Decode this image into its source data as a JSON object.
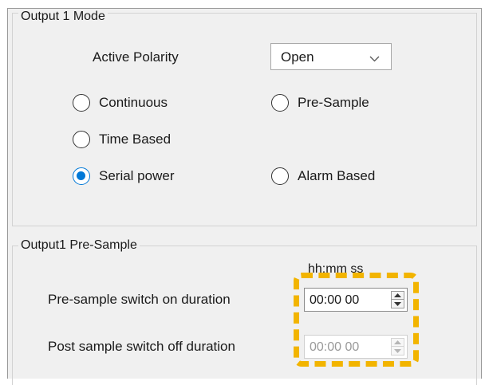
{
  "output1_mode": {
    "title": "Output 1 Mode",
    "active_polarity_label": "Active Polarity",
    "active_polarity_value": "Open",
    "radios": [
      {
        "label": "Continuous",
        "checked": false
      },
      {
        "label": "Pre-Sample",
        "checked": false
      },
      {
        "label": "Time Based",
        "checked": false
      },
      {
        "label": "Serial power",
        "checked": true
      },
      {
        "label": "Alarm Based",
        "checked": false
      }
    ]
  },
  "output1_presample": {
    "title": "Output1 Pre-Sample",
    "time_format_label": "hh:mm ss",
    "switch_on_label": "Pre-sample switch on duration",
    "switch_on_value": "00:00 00",
    "switch_off_label": "Post sample switch off duration",
    "switch_off_value": "00:00 00",
    "switch_off_enabled": false
  },
  "highlight_color": "#f2b400",
  "accent_color": "#0078d7"
}
